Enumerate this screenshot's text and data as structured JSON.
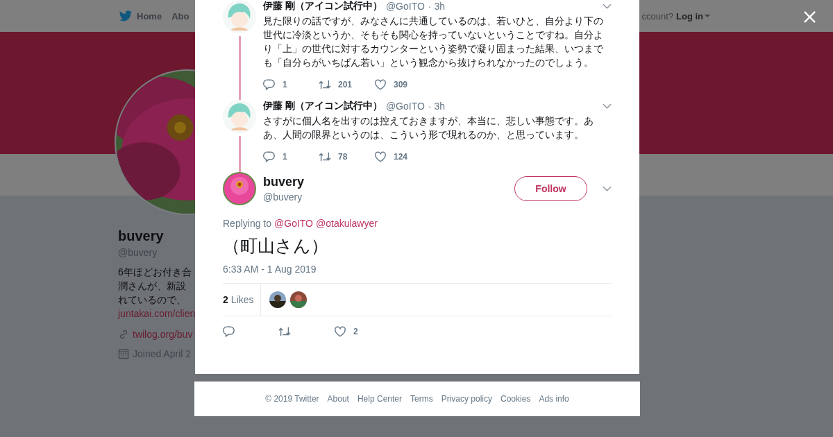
{
  "nav": {
    "items": [
      {
        "label": "Home"
      },
      {
        "label": "Abo"
      }
    ],
    "login_prompt": "ccount?",
    "login": "Log in"
  },
  "profile": {
    "name": "buvery",
    "handle": "@buvery",
    "bio_lines": [
      "6年ほどお付き合",
      "潤さんが、新設",
      "れているので、"
    ],
    "bio_link": "juntakai.com/clien",
    "website": "twilog.org/buv",
    "joined": "Joined April 2"
  },
  "thread": [
    {
      "author": "伊藤 剛（アイコン試行中）",
      "handle": "@GoITO",
      "time": "· 3h",
      "text": "見た限りの話ですが、みなさんに共通しているのは、若いひと、自分より下の世代に冷淡というか、そもそも関心を持っていないということですね。自分より「上」の世代に対するカウンターという姿勢で凝り固まった結果、いつまでも「自分らがいちばん若い」という観念から抜けられなかったのでしょう。",
      "replies": "1",
      "retweets": "201",
      "likes": "309"
    },
    {
      "author": "伊藤 剛（アイコン試行中）",
      "handle": "@GoITO",
      "time": "· 3h",
      "text": "さすがに個人名を出すのは控えておきますが、本当に、悲しい事態です。ああ、人間の限界というのは、こういう形で現れるのか、と思っています。",
      "replies": "1",
      "retweets": "78",
      "likes": "124"
    }
  ],
  "tweet": {
    "name": "buvery",
    "handle": "@buvery",
    "follow": "Follow",
    "replying_label": "Replying to",
    "mentions": [
      "@GoITO",
      "@otakulawyer"
    ],
    "text": "（町山さん）",
    "timestamp": "6:33 AM - 1 Aug 2019",
    "likes_count": "2",
    "likes_label": "Likes",
    "likers": [
      {
        "kind": "picture"
      },
      {
        "kind": "picture"
      }
    ],
    "action_likes": "2"
  },
  "footer": [
    "© 2019 Twitter",
    "About",
    "Help Center",
    "Terms",
    "Privacy policy",
    "Cookies",
    "Ads info"
  ]
}
